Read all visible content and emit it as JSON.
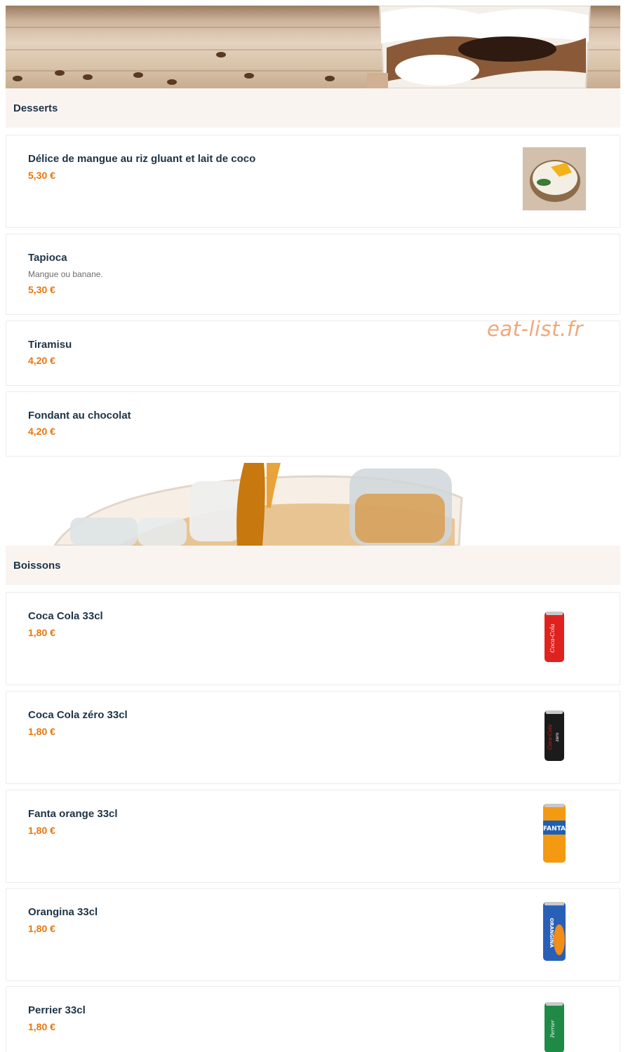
{
  "watermark": "eat-list.fr",
  "sections": [
    {
      "title": "Desserts",
      "items": [
        {
          "name": "Délice de mangue au riz gluant et lait de coco",
          "price": "5,30 €",
          "image": "mango-sticky-rice-bowl"
        },
        {
          "name": "Tapioca",
          "description": "Mangue ou banane.",
          "price": "5,30 €"
        },
        {
          "name": "Tiramisu",
          "price": "4,20 €"
        },
        {
          "name": "Fondant au chocolat",
          "price": "4,20 €"
        }
      ]
    },
    {
      "title": "Boissons",
      "items": [
        {
          "name": "Coca Cola 33cl",
          "price": "1,80 €",
          "image": "coca-cola-can"
        },
        {
          "name": "Coca Cola zéro 33cl",
          "price": "1,80 €",
          "image": "coca-cola-zero-can"
        },
        {
          "name": "Fanta orange 33cl",
          "price": "1,80 €",
          "image": "fanta-can"
        },
        {
          "name": "Orangina 33cl",
          "price": "1,80 €",
          "image": "orangina-can"
        },
        {
          "name": "Perrier 33cl",
          "price": "1,80 €",
          "image": "perrier-can"
        }
      ]
    }
  ],
  "can_labels": {
    "coca": "Coca-Cola",
    "zero_brand": "Coca-Cola",
    "zero": "zero",
    "fanta": "FANTA",
    "orangina": "ORANGINA",
    "perrier": "Perrier"
  },
  "colors": {
    "price": "#e8760c",
    "title": "#1d3446",
    "section_bg": "#faf4f1",
    "watermark": "#f0a87a"
  }
}
